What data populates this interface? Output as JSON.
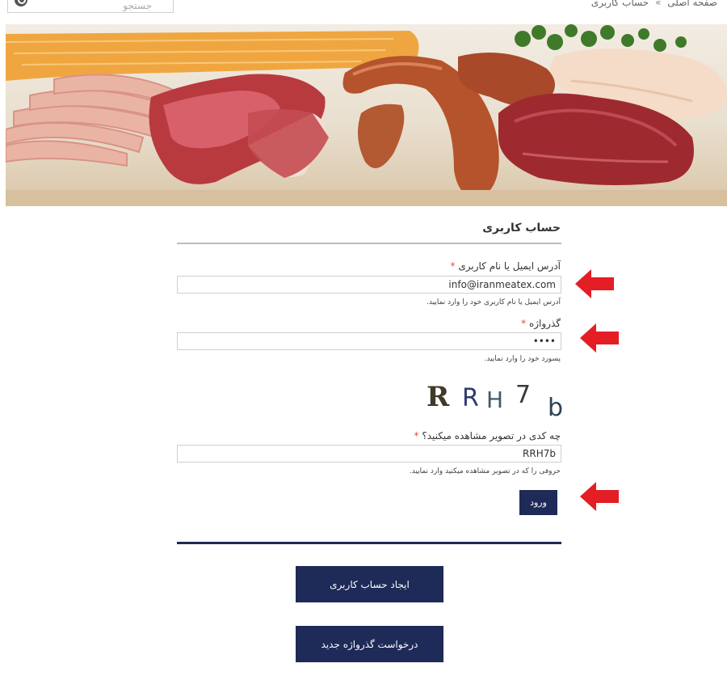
{
  "header": {
    "search_placeholder": "جستجو",
    "breadcrumb": [
      "صفحه اصلی",
      "»",
      "حساب کاربری"
    ]
  },
  "account": {
    "title": "حساب کاربری",
    "email": {
      "label": "آدرس ایمیل یا نام کاربری",
      "required_mark": "*",
      "value": "info@iranmeatex.com",
      "hint": "آدرس ایمیل یا نام کاربری خود را وارد نمایید."
    },
    "password": {
      "label": "گذرواژه",
      "required_mark": "*",
      "value": "••••",
      "hint": "پسورد خود را وارد نمایید."
    },
    "captcha": {
      "chars": [
        "R",
        "R",
        "H",
        "7",
        "b"
      ],
      "label": "چه کدی در تصویر مشاهده میکنید؟",
      "required_mark": "*",
      "value": "RRH7b",
      "hint": "حروفی را که در تصویر مشاهده میکنید وارد نمایید."
    },
    "login_button": "ورود",
    "create_account_button": "ایجاد حساب کاربری",
    "reset_password_button": "درخواست گذرواژه جدید"
  },
  "colors": {
    "button_bg": "#1e2a57",
    "arrow": "#e31e24",
    "required": "#e04a4a"
  }
}
